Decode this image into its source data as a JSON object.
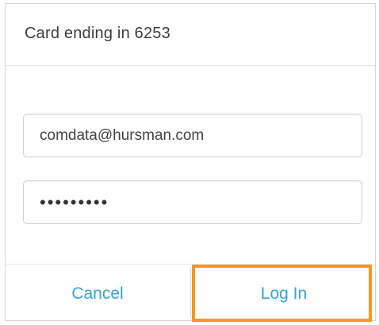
{
  "dialog": {
    "title": "Card ending in 6253",
    "username_value": "comdata@hursman.com",
    "password_mask": "•••••••••",
    "cancel_label": "Cancel",
    "login_label": "Log In"
  },
  "colors": {
    "link_blue": "#3aa1d8",
    "highlight_orange": "#f39a1c"
  }
}
